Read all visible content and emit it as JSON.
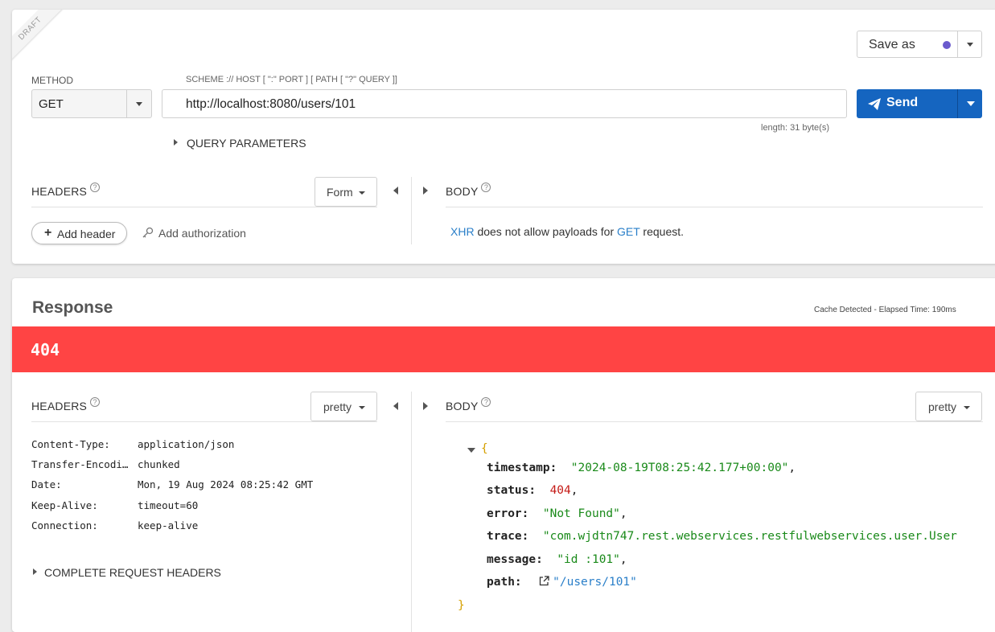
{
  "request": {
    "draft_label": "DRAFT",
    "save_as_label": "Save as",
    "method_label": "METHOD",
    "method_value": "GET",
    "url_label": "SCHEME :// HOST [ \":\" PORT ] [ PATH [ \"?\" QUERY ]]",
    "url_value": "http://localhost:8080/users/101",
    "length_text": "length: 31 byte(s)",
    "send_label": "Send",
    "query_params_label": "QUERY PARAMETERS",
    "headers_title": "HEADERS",
    "headers_mode": "Form",
    "add_header_label": "Add header",
    "add_auth_label": "Add authorization",
    "body_title": "BODY",
    "body_note_xhr": "XHR",
    "body_note_mid": " does not allow payloads for ",
    "body_note_get": "GET",
    "body_note_end": " request.",
    "help_glyph": "?"
  },
  "response": {
    "title": "Response",
    "meta": "Cache Detected - Elapsed Time: 190ms",
    "status_code": "404",
    "status_color": "#ff4444",
    "headers_title": "HEADERS",
    "headers_mode": "pretty",
    "headers": [
      {
        "key": "Content-Type:",
        "value": "application/json"
      },
      {
        "key": "Transfer-Encodi…",
        "value": "chunked"
      },
      {
        "key": "Date:",
        "value": "Mon, 19 Aug 2024 08:25:42 GMT"
      },
      {
        "key": "Keep-Alive:",
        "value": "timeout=60"
      },
      {
        "key": "Connection:",
        "value": "keep-alive"
      }
    ],
    "complete_request_headers_label": "COMPLETE REQUEST HEADERS",
    "body_title": "BODY",
    "body_mode": "pretty",
    "json": {
      "open_brace": "{",
      "close_brace": "}",
      "timestamp_key": "timestamp:",
      "timestamp_val": "\"2024-08-19T08:25:42.177+00:00\"",
      "status_key": "status:",
      "status_val": "404",
      "error_key": "error:",
      "error_val": "\"Not Found\"",
      "trace_key": "trace:",
      "trace_val": "\"com.wjdtn747.rest.webservices.restfulwebservices.user.User",
      "message_key": "message:",
      "message_val": "\"id :101\"",
      "path_key": "path:",
      "path_val": "\"/users/101\"",
      "comma": ","
    }
  },
  "colors": {
    "send_button": "#1565c0",
    "status_bar": "#ff4444",
    "link_blue": "#2a7fc9",
    "save_dot": "#6a5acd"
  }
}
